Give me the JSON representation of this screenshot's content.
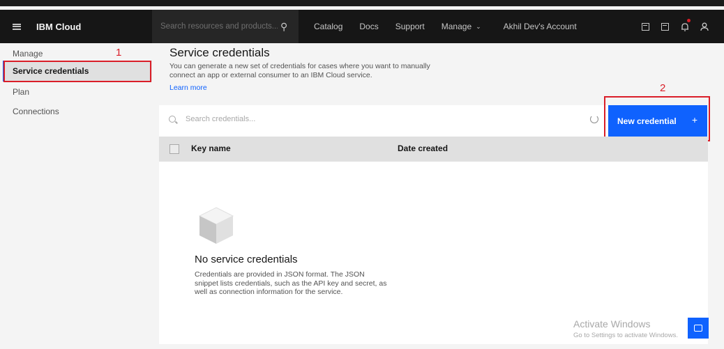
{
  "header": {
    "brand": "IBM Cloud",
    "search_placeholder": "Search resources and products...",
    "nav": [
      {
        "label": "Catalog"
      },
      {
        "label": "Docs"
      },
      {
        "label": "Support"
      },
      {
        "label": "Manage"
      }
    ],
    "account": "Akhil Dev's Account",
    "icons": [
      "menu-icon",
      "search-icon",
      "chevron-down-icon",
      "cost-estimator-icon",
      "calendar-icon",
      "notification-bell-icon",
      "user-avatar-icon"
    ]
  },
  "sidenav": {
    "items": [
      {
        "label": "Manage"
      },
      {
        "label": "Service credentials",
        "active": true
      },
      {
        "label": "Plan"
      },
      {
        "label": "Connections"
      }
    ]
  },
  "annotations": {
    "one": "1",
    "two": "2",
    "color": "#da1e28"
  },
  "main": {
    "title": "Service credentials",
    "description": "You can generate a new set of credentials for cases where you want to manually connect an app or external consumer to an IBM Cloud service.",
    "learn_more": "Learn more",
    "toolbar": {
      "search_placeholder": "Search credentials...",
      "new_credential_label": "New credential",
      "plus": "+"
    },
    "table": {
      "columns": [
        "Key name",
        "Date created"
      ]
    },
    "empty_state": {
      "title": "No service credentials",
      "description": "Credentials are provided in JSON format. The JSON snippet lists credentials, such as the API key and secret, as well as connection information for the service."
    }
  },
  "watermark": {
    "title": "Activate Windows",
    "subtitle": "Go to Settings to activate Windows."
  },
  "colors": {
    "accent": "#0f62fe",
    "header_bg": "#161616"
  }
}
